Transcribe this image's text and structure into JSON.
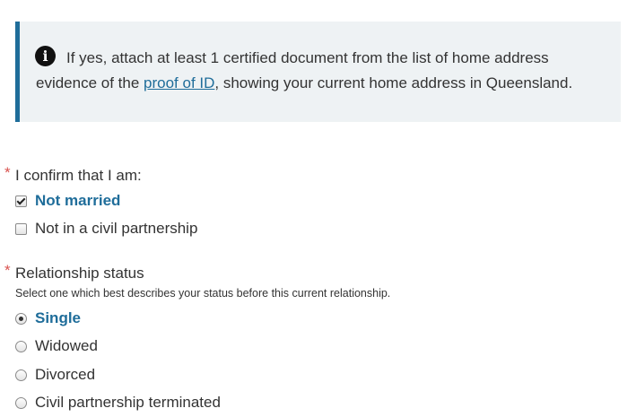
{
  "callout": {
    "text_before_link": "If yes, attach at least 1 certified document from the list of home address evidence of the ",
    "link_text": "proof of ID",
    "text_after_link": ", showing your current home address in Queensland."
  },
  "confirm_field": {
    "required_marker": "*",
    "label": "I confirm that I am:",
    "options": [
      {
        "label": "Not married",
        "checked": true
      },
      {
        "label": "Not in a civil partnership",
        "checked": false
      }
    ]
  },
  "relationship_field": {
    "required_marker": "*",
    "label": "Relationship status",
    "hint": "Select one which best describes your status before this current relationship.",
    "options": [
      {
        "label": "Single",
        "selected": true
      },
      {
        "label": "Widowed",
        "selected": false
      },
      {
        "label": "Divorced",
        "selected": false
      },
      {
        "label": "Civil partnership terminated",
        "selected": false
      }
    ]
  },
  "colors": {
    "accent": "#1f6d9a",
    "callout_bg": "#eef2f4",
    "required": "#d9534f"
  },
  "icons": {
    "callout_icon": "info-icon"
  }
}
